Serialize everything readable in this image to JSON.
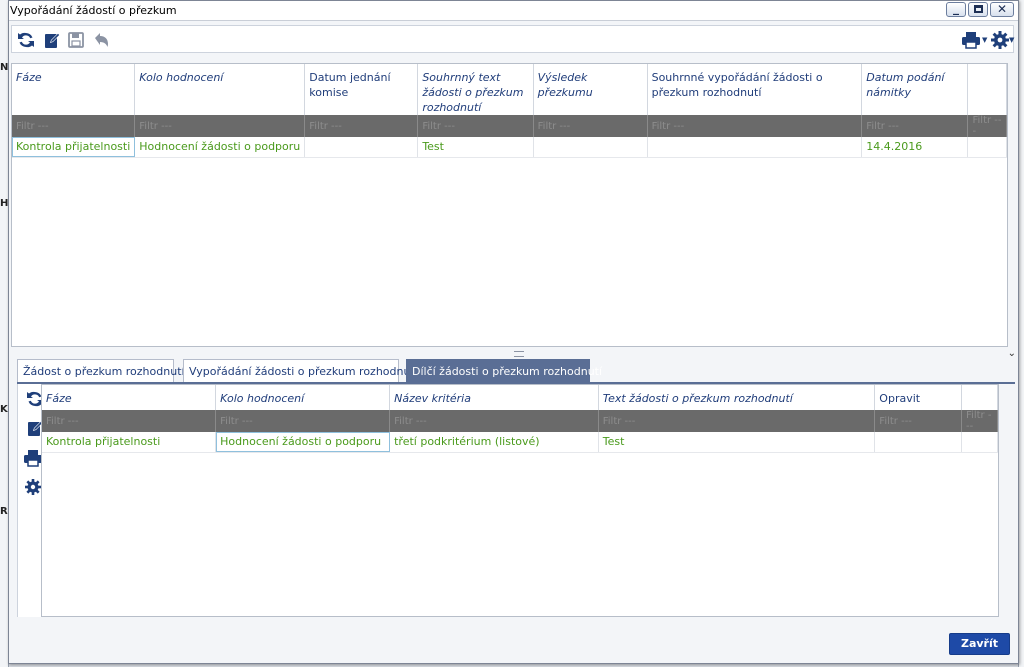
{
  "window": {
    "title": "Vypořádání žádostí o přezkum",
    "controls": [
      "minimize",
      "maximize",
      "close"
    ]
  },
  "background_letters": [
    "N",
    "H",
    "K",
    "R"
  ],
  "toolbar": {
    "left_icons": [
      "refresh-icon",
      "edit-icon",
      "save-icon",
      "undo-icon"
    ],
    "right_icons": [
      "print-icon",
      "settings-icon"
    ]
  },
  "top_grid": {
    "columns": [
      {
        "label": "Fáze",
        "italic": true
      },
      {
        "label": "Kolo hodnocení",
        "italic": true
      },
      {
        "label": "Datum jednání komise",
        "italic": false
      },
      {
        "label": "Souhrnný text žádosti o přezkum rozhodnutí",
        "italic": true
      },
      {
        "label": "Výsledek přezkumu",
        "italic": true
      },
      {
        "label": "Souhrnné vypořádání žádosti o přezkum rozhodnutí",
        "italic": false
      },
      {
        "label": "Datum podání námitky",
        "italic": true
      },
      {
        "label": "",
        "italic": false
      }
    ],
    "filter_placeholder": "Filtr ---",
    "rows": [
      [
        "Kontrola přijatelnosti",
        "Hodnocení žádosti o podporu",
        "",
        "Test",
        "",
        "",
        "14.4.2016",
        ""
      ]
    ]
  },
  "tabs": [
    {
      "label": "Žádost o přezkum rozhodnutí",
      "active": false
    },
    {
      "label": "Vypořádání žádosti o přezkum rozhodnutí",
      "active": false
    },
    {
      "label": "Dílčí žádosti o přezkum rozhodnutí",
      "active": true
    }
  ],
  "side_tools": [
    "refresh-icon",
    "edit-icon",
    "print-icon",
    "settings-icon"
  ],
  "bottom_grid": {
    "columns": [
      {
        "label": "Fáze",
        "italic": true
      },
      {
        "label": "Kolo hodnocení",
        "italic": true
      },
      {
        "label": "Název kritéria",
        "italic": true
      },
      {
        "label": "Text žádosti o přezkum rozhodnutí",
        "italic": true
      },
      {
        "label": "Opravit",
        "italic": false
      },
      {
        "label": "",
        "italic": false
      }
    ],
    "filter_placeholder": "Filtr ---",
    "rows": [
      [
        "Kontrola přijatelnosti",
        "Hodnocení žádosti o podporu",
        "třetí podkritérium (listové)",
        "Test",
        "",
        ""
      ]
    ]
  },
  "footer": {
    "close_label": "Zavřít"
  },
  "colors": {
    "accent": "#1e4aa7",
    "tab_active": "#5a6e95",
    "data_text": "#4a9a1c",
    "header_text": "#203d7a",
    "filter_bg": "#6a6a6a"
  }
}
